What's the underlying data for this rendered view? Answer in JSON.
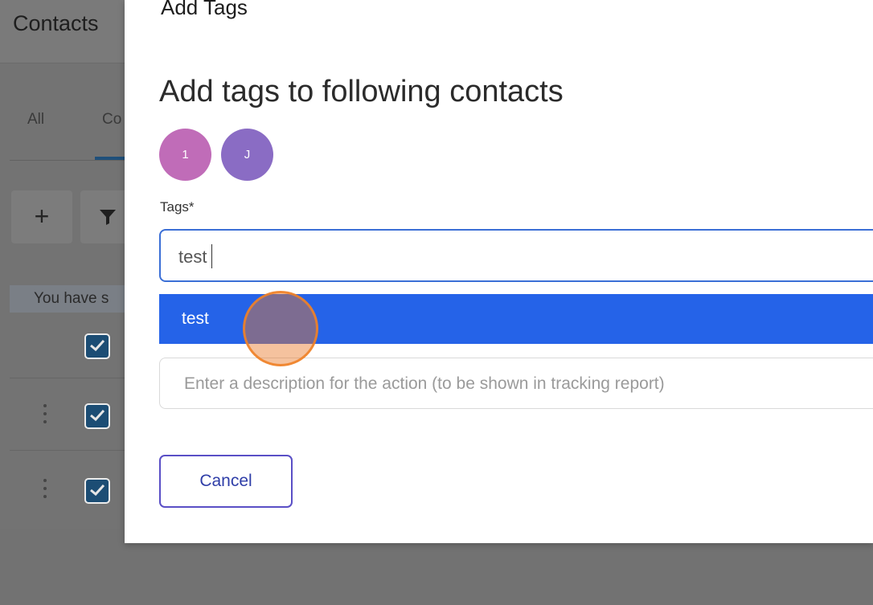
{
  "background": {
    "page_title": "Contacts",
    "tabs": [
      {
        "label": "All"
      },
      {
        "label": "Co"
      }
    ],
    "toolbar": {
      "add_glyph": "+",
      "filter_icon": "filter-icon"
    },
    "selection_banner": "You have s"
  },
  "modal": {
    "title": "Add Tags",
    "subtitle": "Add tags to following contacts",
    "avatars": [
      {
        "initial": "1",
        "color": "#c06cb8"
      },
      {
        "initial": "J",
        "color": "#8a6cc4"
      }
    ],
    "tags_label": "Tags*",
    "tags_input_value": "test",
    "dropdown_options": [
      {
        "label": "test",
        "highlighted": true
      }
    ],
    "description_placeholder": "Enter a description for the action (to be shown in tracking report)",
    "cancel_label": "Cancel"
  },
  "colors": {
    "accent": "#2563e8",
    "input_focus_border": "#3b6fd6",
    "cancel_border": "#5a4fc6",
    "click_indicator": "#e87828"
  }
}
